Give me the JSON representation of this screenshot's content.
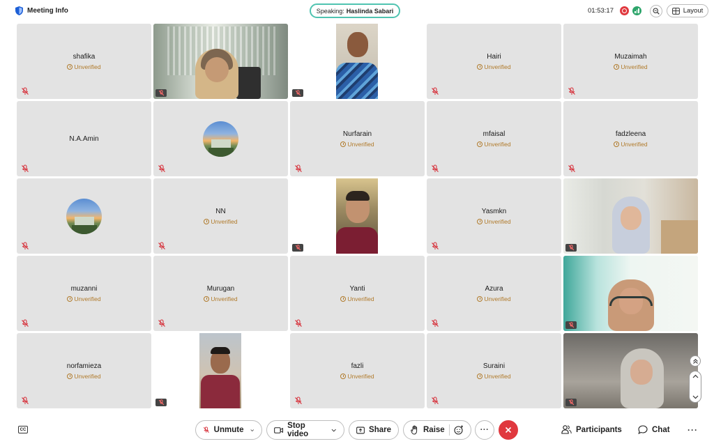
{
  "header": {
    "meeting_info_label": "Meeting Info",
    "speaking_prefix": "Speaking:",
    "speaking_name": "Haslinda Sabari",
    "timer": "01:53:17",
    "layout_label": "Layout"
  },
  "status_label": "Unverified",
  "tiles": {
    "r1c1": {
      "name": "shafika"
    },
    "r1c4": {
      "name": "Hairi"
    },
    "r1c5": {
      "name": "Muzaimah"
    },
    "r2c1": {
      "name": "N.A.Amin"
    },
    "r2c3": {
      "name": "Nurfarain"
    },
    "r2c4": {
      "name": "mfaisal"
    },
    "r2c5": {
      "name": "fadzleena"
    },
    "r3c2": {
      "name": "NN"
    },
    "r3c4": {
      "name": "Yasmkn"
    },
    "r4c1": {
      "name": "muzanni"
    },
    "r4c2": {
      "name": "Murugan"
    },
    "r4c3": {
      "name": "Yanti"
    },
    "r4c4": {
      "name": "Azura"
    },
    "r5c1": {
      "name": "norfamieza"
    },
    "r5c3": {
      "name": "fazli"
    },
    "r5c4": {
      "name": "Suraini"
    }
  },
  "controls": {
    "unmute": "Unmute",
    "stop_video": "Stop video",
    "share": "Share",
    "raise": "Raise",
    "participants": "Participants",
    "chat": "Chat",
    "cc": "CC",
    "more": "···"
  },
  "colors": {
    "accent_speaking": "#4fc3b0",
    "leave": "#e0383e",
    "recording": "#e0383e",
    "network": "#2ea56b",
    "mute_red": "#d7303a",
    "unverified": "#b07a2a"
  }
}
